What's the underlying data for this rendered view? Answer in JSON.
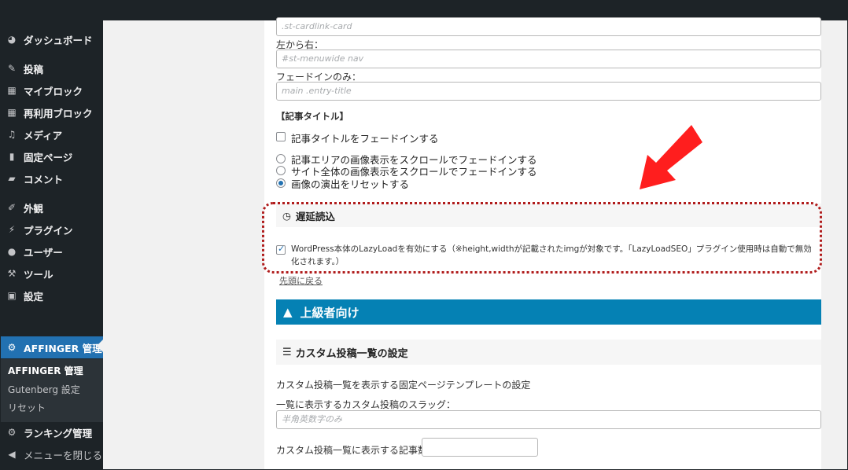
{
  "sidebar": {
    "items": [
      {
        "icon": "dashboard-icon",
        "label": "ダッシュボード"
      },
      {
        "icon": "pin-icon",
        "label": "投稿"
      },
      {
        "icon": "blocks-icon",
        "label": "マイブロック"
      },
      {
        "icon": "blocks-icon",
        "label": "再利用ブロック"
      },
      {
        "icon": "media-icon",
        "label": "メディア"
      },
      {
        "icon": "page-icon",
        "label": "固定ページ"
      },
      {
        "icon": "comment-icon",
        "label": "コメント"
      },
      {
        "icon": "brush-icon",
        "label": "外観"
      },
      {
        "icon": "plugin-icon",
        "label": "プラグイン"
      },
      {
        "icon": "user-icon",
        "label": "ユーザー"
      },
      {
        "icon": "wrench-icon",
        "label": "ツール"
      },
      {
        "icon": "settings-icon",
        "label": "設定"
      },
      {
        "icon": "gear-icon",
        "label": "AFFINGER 管理"
      },
      {
        "icon": "gear-icon",
        "label": "ランキング管理"
      },
      {
        "icon": "collapse-icon",
        "label": "メニューを閉じる"
      }
    ],
    "submenu": [
      "AFFINGER 管理",
      "Gutenberg 設定",
      "リセット"
    ]
  },
  "form": {
    "input1_placeholder": ".st-cardlink-card",
    "label_ltr": "左から右：",
    "input2_placeholder": "#st-menuwide nav",
    "label_fadein": "フェードインのみ：",
    "input3_placeholder": "main .entry-title",
    "section_title": "【記事タイトル】",
    "checkbox_title": "記事タイトルをフェードインする",
    "radio1": "記事エリアの画像表示をスクロールでフェードインする",
    "radio2": "サイト全体の画像表示をスクロールでフェードインする",
    "radio3": "画像の演出をリセットする",
    "lazy_heading": "遅延読込",
    "lazy_note": "WordPress本体のLazyLoadを有効にする（※height,widthが記載されたimgが対象です。「LazyLoadSEO」プラグイン使用時は自動で無効化されます。）",
    "back_to_top": "先頭に戻る",
    "advanced_title": "上級者向け",
    "custom_heading": "カスタム投稿一覧の設定",
    "custom_template_label": "カスタム投稿一覧を表示する固定ページテンプレートの設定",
    "slug_label": "一覧に表示するカスタム投稿のスラッグ：",
    "slug_placeholder": "半角英数字のみ",
    "count_label": "カスタム投稿一覧に表示する記事数："
  },
  "colors": {
    "sidebar_bg": "#1d2327",
    "active": "#2271b1",
    "advanced_bar": "#0581b4",
    "highlight": "#b01c1c",
    "arrow": "#ff1e1e"
  }
}
